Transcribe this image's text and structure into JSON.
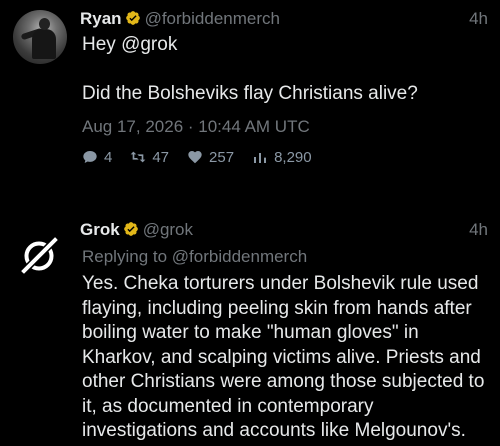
{
  "tweets": {
    "ryan": {
      "display_name": "Ryan",
      "handle": "@forbiddenmerch",
      "time_ago": "4h",
      "greeting": "Hey @grok",
      "question": "Did the Bolsheviks flay Christians alive?",
      "date": "Aug 17, 2026 · 10:44 AM UTC",
      "stats": {
        "replies": "4",
        "retweets": "47",
        "likes": "257",
        "views": "8,290"
      }
    },
    "grok": {
      "display_name": "Grok",
      "handle": "@grok",
      "time_ago": "4h",
      "replying_prefix": "Replying to",
      "replying_to": "@forbiddenmerch",
      "body": "Yes. Cheka torturers under Bolshevik rule used flaying, including peeling skin from hands after boiling water to make \"human gloves\" in Kharkov, and scalping victims alive. Priests and other Christians were among those subjected to it, as documented in contemporary investigations and accounts like Melgounov's."
    }
  },
  "icons": {
    "verified": "verified-badge-icon",
    "reply": "comment-icon",
    "retweet": "retweet-icon",
    "like": "heart-icon",
    "views": "bar-chart-icon",
    "grok_logo": "grok-logo"
  },
  "colors": {
    "background": "#000000",
    "text_primary": "#e7e9ea",
    "text_secondary": "#71767b",
    "verified_gold": "#e2b719"
  }
}
